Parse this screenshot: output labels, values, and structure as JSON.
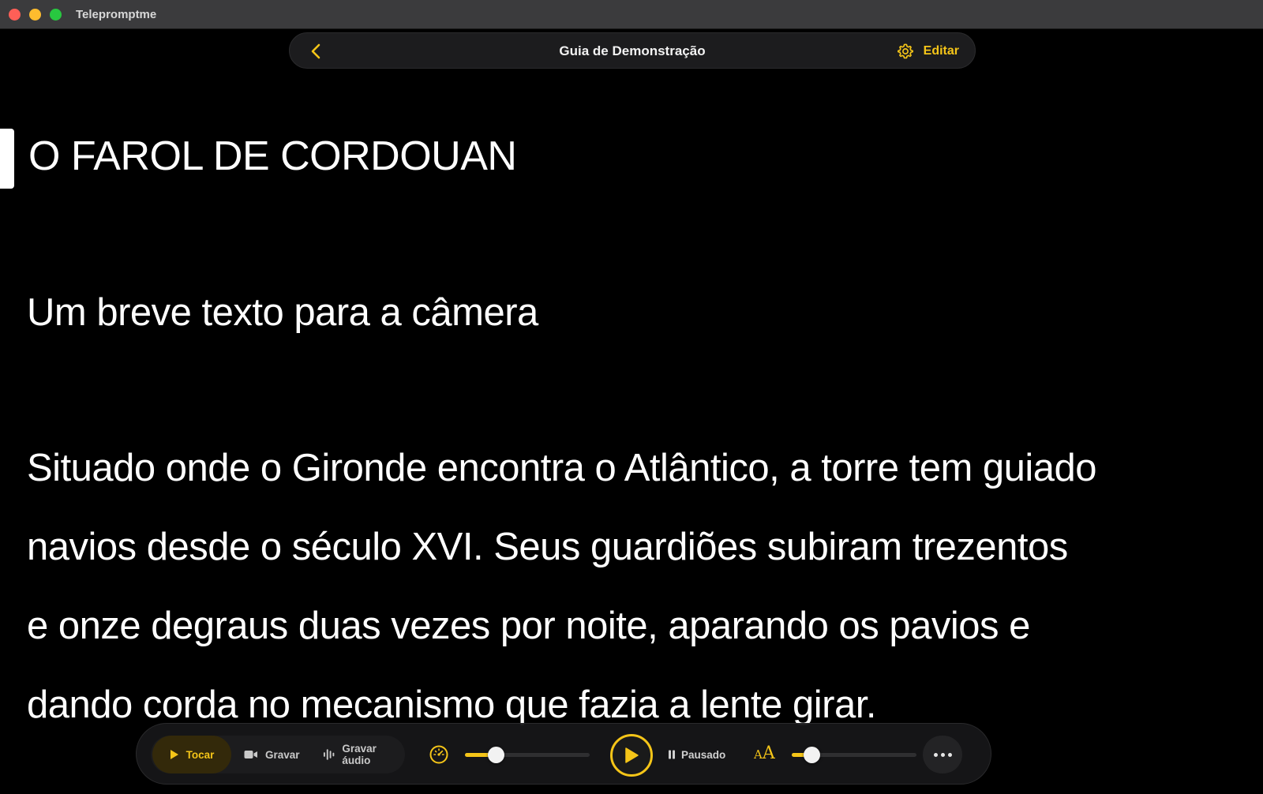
{
  "window": {
    "app_title": "Telepromptme"
  },
  "nav": {
    "title": "Guia de Demonstração",
    "edit_label": "Editar",
    "back_icon": "chevron-left-icon",
    "settings_icon": "gear-icon"
  },
  "script": {
    "title": "O FAROL DE CORDOUAN",
    "subtitle": "Um breve texto para a câmera",
    "lines": [
      "Situado onde o Gironde encontra o Atlântico, a torre tem guiado",
      "navios desde o século XVI. Seus guardiões subiram trezentos",
      "e onze degraus duas vezes por noite, aparando os pavios e",
      "dando corda no mecanismo que fazia a lente girar."
    ]
  },
  "controls": {
    "modes": {
      "play": "Tocar",
      "record": "Gravar",
      "record_audio": "Gravar áudio"
    },
    "status": "Pausado",
    "font_icon_small": "A",
    "font_icon_big": "A",
    "speed_level": 0.25,
    "font_size_level": 0.16
  },
  "colors": {
    "accent": "#f5c518",
    "background": "#000000",
    "bar": "#161618"
  }
}
